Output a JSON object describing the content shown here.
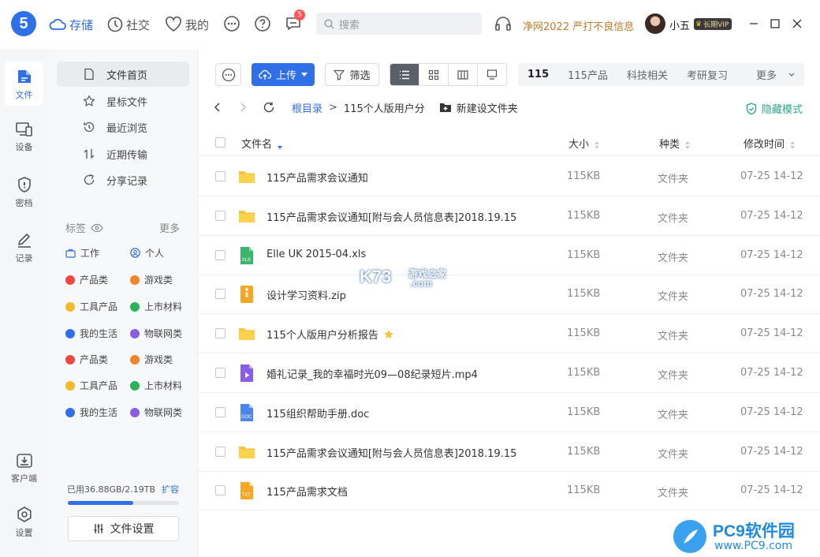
{
  "app": {
    "logo_char": "5"
  },
  "topnav": [
    {
      "label": "存储",
      "icon": "cloud-icon",
      "active": true
    },
    {
      "label": "社交",
      "icon": "clock-icon",
      "active": false
    },
    {
      "label": "我的",
      "icon": "heart-icon",
      "active": false
    }
  ],
  "badge_count": "5",
  "search": {
    "placeholder": "搜索"
  },
  "notice": "净网2022 严打不良信息",
  "user": {
    "name": "小五",
    "vip": "长期VIP"
  },
  "rail": [
    {
      "label": "文件",
      "icon": "file-icon"
    },
    {
      "label": "设备",
      "icon": "device-icon"
    },
    {
      "label": "密档",
      "icon": "shield-icon"
    },
    {
      "label": "记录",
      "icon": "pen-icon"
    },
    {
      "label": "客户端",
      "icon": "download-icon"
    },
    {
      "label": "设置",
      "icon": "settings-icon"
    }
  ],
  "sidenav": [
    {
      "label": "文件首页",
      "icon": "doc-icon"
    },
    {
      "label": "星标文件",
      "icon": "star-icon"
    },
    {
      "label": "最近浏览",
      "icon": "history-icon"
    },
    {
      "label": "近期传输",
      "icon": "transfer-icon"
    },
    {
      "label": "分享记录",
      "icon": "share-icon"
    }
  ],
  "tags": {
    "header": "标签",
    "more": "更多",
    "items": [
      {
        "label": "工作",
        "color": "#2f6fe8"
      },
      {
        "label": "个人",
        "color": "#2f6fe8"
      },
      {
        "label": "产品类",
        "color": "#f0483e"
      },
      {
        "label": "游戏类",
        "color": "#f5832a"
      },
      {
        "label": "工具产品",
        "color": "#f5b82a"
      },
      {
        "label": "上市材料",
        "color": "#2bb35a"
      },
      {
        "label": "我的生活",
        "color": "#2f6fe8"
      },
      {
        "label": "物联网类",
        "color": "#8a5de8"
      },
      {
        "label": "产品类",
        "color": "#f0483e"
      },
      {
        "label": "游戏类",
        "color": "#f5832a"
      },
      {
        "label": "工具产品",
        "color": "#f5b82a"
      },
      {
        "label": "上市材料",
        "color": "#2bb35a"
      },
      {
        "label": "我的生活",
        "color": "#2f6fe8"
      },
      {
        "label": "物联网类",
        "color": "#8a5de8"
      }
    ]
  },
  "storage": {
    "text": "已用36.88GB/2.19TB",
    "expand": "扩容",
    "used_fraction": 0.59
  },
  "settings_btn": "文件设置",
  "toolbar": {
    "upload": "上传",
    "filter": "筛选"
  },
  "cats": [
    "115",
    "115产品",
    "科技相关",
    "考研复习",
    "更多"
  ],
  "breadcrumb": {
    "root": "根目录",
    "current": "115个人版用户分",
    "new_folder": "新建设文件夹"
  },
  "hide_mode": "隐藏模式",
  "columns": {
    "name": "文件名",
    "size": "大小",
    "type": "种类",
    "time": "修改时间"
  },
  "files": [
    {
      "name": "115产品需求会议通知",
      "size": "115KB",
      "type": "文件夹",
      "time": "07-25 14-12",
      "icon": "folder-icon",
      "starred": false
    },
    {
      "name": "115产品需求会议通知[附与会人员信息表]2018.19.15",
      "size": "115KB",
      "type": "文件夹",
      "time": "07-25 14-12",
      "icon": "folder-icon",
      "starred": false
    },
    {
      "name": "Elle UK 2015-04.xls",
      "size": "115KB",
      "type": "文件夹",
      "time": "07-25 14-12",
      "icon": "xls-icon",
      "starred": false
    },
    {
      "name": "设计学习资料.zip",
      "size": "115KB",
      "type": "文件夹",
      "time": "07-25 14-12",
      "icon": "zip-icon",
      "starred": false
    },
    {
      "name": "115个人版用户分析报告",
      "size": "115KB",
      "type": "文件夹",
      "time": "07-25 14-12",
      "icon": "folder-icon",
      "starred": true
    },
    {
      "name": "婚礼记录_我的幸福时光09—08纪录短片.mp4",
      "size": "115KB",
      "type": "文件夹",
      "time": "07-25 14-12",
      "icon": "video-icon",
      "starred": false
    },
    {
      "name": "115组织帮助手册.doc",
      "size": "115KB",
      "type": "文件夹",
      "time": "07-25 14-12",
      "icon": "doc-file-icon",
      "starred": false
    },
    {
      "name": "115产品需求会议通知[附与会人员信息表]2018.19.15",
      "size": "115KB",
      "type": "文件夹",
      "time": "07-25 14-12",
      "icon": "folder-icon",
      "starred": false
    },
    {
      "name": "115产品需求文档",
      "size": "115KB",
      "type": "文件夹",
      "time": "07-25 14-12",
      "icon": "txt-icon",
      "starred": false
    }
  ],
  "watermark": {
    "k73": "K73",
    "k73_sub": "游戏之家",
    "k73_domain": ".com",
    "pc9": "PC9软件园",
    "pc9_url": "www.PC9.com"
  }
}
